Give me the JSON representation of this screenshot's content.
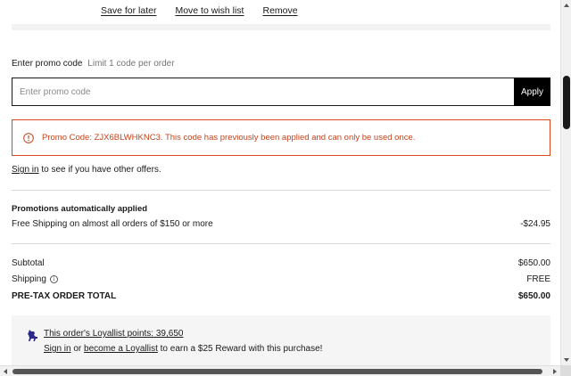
{
  "item_actions": {
    "save_for_later": "Save for later",
    "move_to_wish_list": "Move to wish list",
    "remove": "Remove"
  },
  "promo": {
    "label": "Enter promo code",
    "limit_note": "Limit 1 code per order",
    "input_placeholder": "Enter promo code",
    "input_value": "",
    "apply_label": "Apply",
    "error_message": "Promo Code: ZJX6BLWHKNC3. This code has previously been applied and can only be used once.",
    "error_icon": "alert-circle-icon"
  },
  "signin": {
    "link_text": "Sign in",
    "rest_text": " to see if you have other offers."
  },
  "promotions": {
    "title": "Promotions automatically applied",
    "items": [
      {
        "label": "Free Shipping on almost all orders of $150 or more",
        "amount": "-$24.95"
      }
    ]
  },
  "summary": {
    "subtotal_label": "Subtotal",
    "subtotal_value": "$650.00",
    "shipping_label": "Shipping",
    "shipping_info_icon": "info-icon",
    "shipping_value": "FREE",
    "total_label": "PRE-TAX ORDER TOTAL",
    "total_value": "$650.00"
  },
  "loyallist": {
    "icon": "loyallist-dog-icon",
    "points_text": "This order's Loyallist points: 39,650",
    "signin_link": "Sign in",
    "or_text": " or ",
    "become_link": "become a Loyallist",
    "reward_text": " to earn a $25 Reward with this purchase!"
  },
  "colors": {
    "error": "#d9471f",
    "button_bg": "#000000",
    "loyallist_icon": "#2b2a8c"
  }
}
